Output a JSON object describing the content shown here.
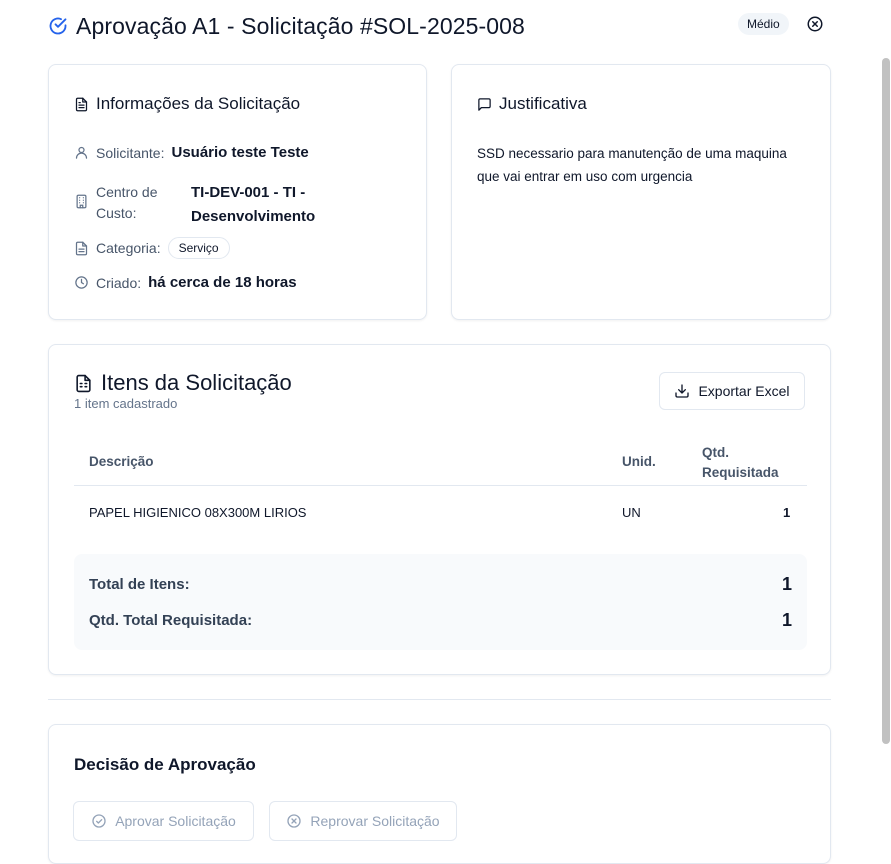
{
  "header": {
    "title": "Aprovação A1 - Solicitação #SOL-2025-008",
    "priority_badge": "Médio",
    "icon": "check-circle-icon",
    "close_icon": "close-circle-icon"
  },
  "info_card": {
    "title": "Informações da Solicitação",
    "requester_label": "Solicitante:",
    "requester_value": "Usuário teste Teste",
    "cost_center_label_line1": "Centro de",
    "cost_center_label_line2": "Custo:",
    "cost_center_value_line1": "TI-DEV-001 - TI -",
    "cost_center_value_line2": "Desenvolvimento",
    "category_label": "Categoria:",
    "category_value": "Serviço",
    "created_label": "Criado:",
    "created_value": "há cerca de 18 horas"
  },
  "justification_card": {
    "title": "Justificativa",
    "text": "SSD necessario para manutenção de uma maquina que vai entrar em uso com urgencia"
  },
  "items_card": {
    "title": "Itens da Solicitação",
    "subtitle": "1 item cadastrado",
    "export_button": "Exportar Excel",
    "columns": {
      "description": "Descrição",
      "unit": "Unid.",
      "qty_line1": "Qtd.",
      "qty_line2": "Requisitada"
    },
    "rows": [
      {
        "description": "PAPEL HIGIENICO 08X300M LIRIOS",
        "unit": "UN",
        "qty": "1"
      }
    ],
    "totals": {
      "items_label": "Total de Itens:",
      "items_value": "1",
      "qty_label": "Qtd. Total Requisitada:",
      "qty_value": "1"
    }
  },
  "decision_card": {
    "title": "Decisão de Aprovação",
    "approve_button": "Aprovar Solicitação",
    "reject_button": "Reprovar Solicitação"
  },
  "colors": {
    "accent": "#2563eb",
    "border": "#e2e8f0",
    "muted_text": "#64748b",
    "disabled_text": "#94a3b8"
  }
}
